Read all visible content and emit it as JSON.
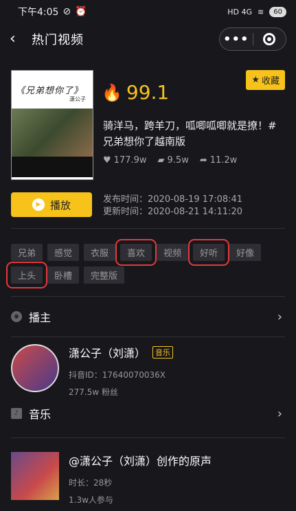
{
  "status": {
    "time": "下午4:05",
    "battery": "60",
    "network": "HD 4G"
  },
  "nav": {
    "title": "热门视频",
    "back": "<",
    "more": "•••"
  },
  "video": {
    "cover_title": "《兄弟想你了》",
    "cover_sub": "潇公子",
    "favorite": "收藏",
    "score": "99.1",
    "description": "骑洋马，跨羊刀，呱唧呱唧就是撩！#兄弟想你了越南版",
    "likes": "177.9w",
    "comments": "9.5w",
    "shares": "11.2w",
    "play": "播放",
    "published": "发布时间：2020-08-19 17:08:41",
    "updated": "更新时间：2020-08-21 14:11:20"
  },
  "tags": [
    "兄弟",
    "感觉",
    "衣服",
    "喜欢",
    "视频",
    "好听",
    "好像",
    "上头",
    "卧槽",
    "完整版"
  ],
  "host_section": {
    "label": "播主"
  },
  "creator": {
    "name": "潇公子（刘潇）",
    "badge": "音乐",
    "douyin_id": "抖音ID：17640070036X",
    "fans": "277.5w 粉丝"
  },
  "music_section": {
    "label": "音乐"
  },
  "music": {
    "title": "@潇公子（刘潇）创作的原声",
    "duration": "时长：28秒",
    "participants": "1.3w人参与"
  },
  "colors": {
    "accent": "#f7c31b",
    "background": "#17171c",
    "highlight_box": "#e23b3b"
  }
}
